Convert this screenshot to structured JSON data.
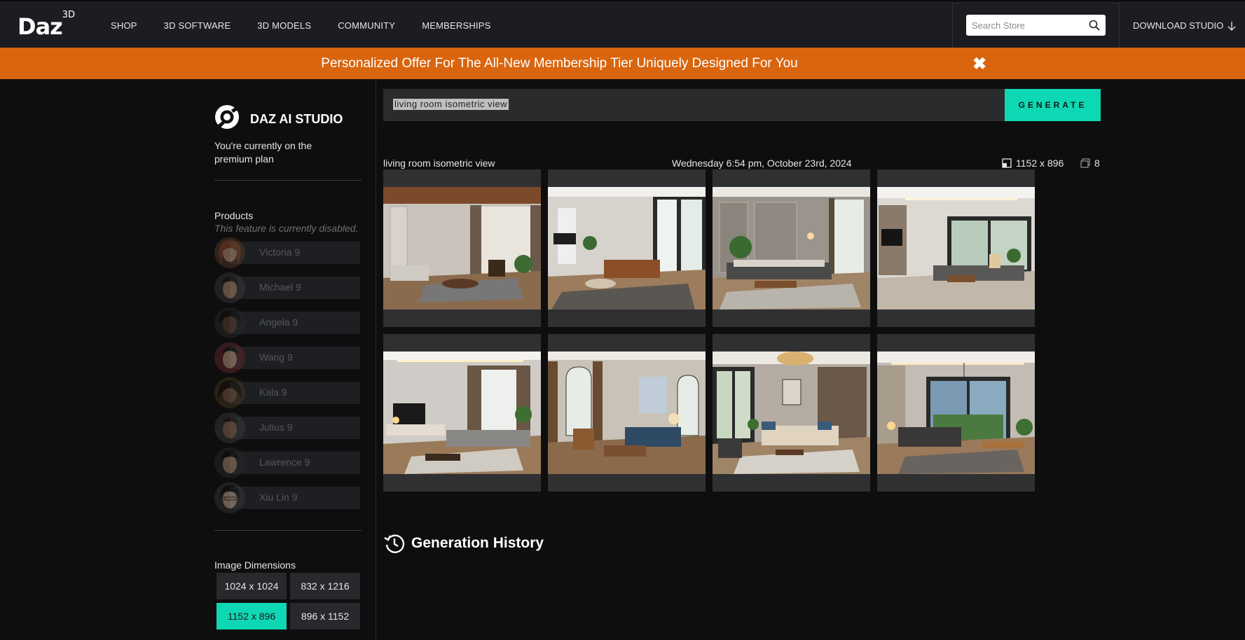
{
  "nav": {
    "logo": "Daz",
    "logo_sup": "3D",
    "links": [
      "SHOP",
      "3D SOFTWARE",
      "3D MODELS",
      "COMMUNITY",
      "MEMBERSHIPS"
    ],
    "search_placeholder": "Search Store",
    "download_label": "DOWNLOAD STUDIO"
  },
  "promo": {
    "text": "Personalized Offer For The All-New Membership Tier Uniquely Designed For You",
    "close_glyph": "✖"
  },
  "sidebar": {
    "title": "DAZ AI STUDIO",
    "plan_text": "You're currently on the premium plan",
    "products_label": "Products",
    "disabled_note": "This feature is currently disabled.",
    "products": [
      "Victoria 9",
      "Michael 9",
      "Angela 9",
      "Wang 9",
      "Kala 9",
      "Julius 9",
      "Lawrence 9",
      "Xiu Lin 9"
    ],
    "dimensions_label": "Image Dimensions",
    "dimensions": [
      "1024 x 1024",
      "832 x 1216",
      "1152 x 896",
      "896 x 1152"
    ],
    "selected_dimension": "1152 x 896"
  },
  "main": {
    "prompt_value": "living room isometric view",
    "generate_label": "GENERATE",
    "result_prompt": "living room isometric view",
    "result_date": "Wednesday 6:54 pm, October 23rd, 2024",
    "result_size": "1152 x 896",
    "result_count": "8",
    "history_title": "Generation History"
  },
  "colors": {
    "accent": "#0ed8b4",
    "promo": "#d9650e",
    "nav_bg": "#1b1d20",
    "page_bg": "#0e0e0f"
  }
}
